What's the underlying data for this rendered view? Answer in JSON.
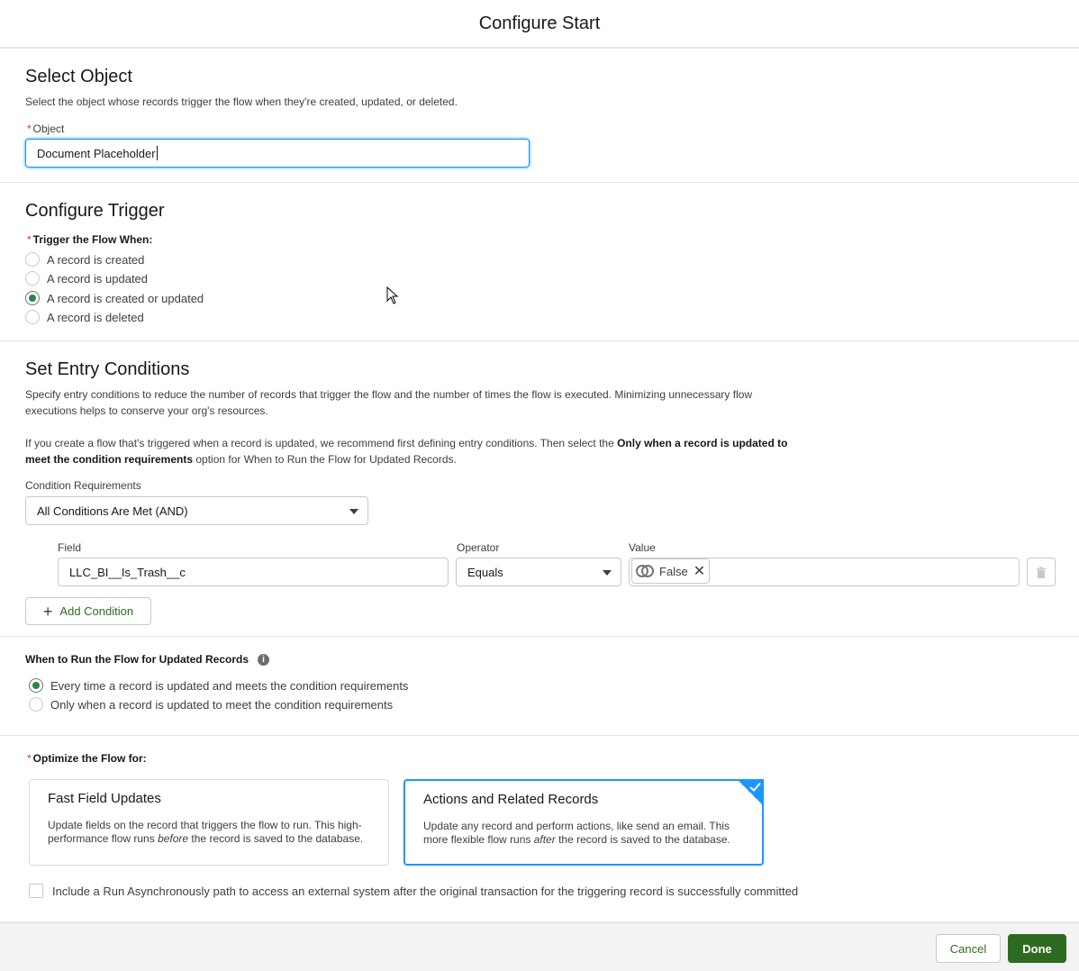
{
  "modal": {
    "title": "Configure Start"
  },
  "select_object": {
    "title": "Select Object",
    "help": "Select the object whose records trigger the flow when they're created, updated, or deleted.",
    "object_label": "Object",
    "object_value": "Document Placeholder"
  },
  "trigger": {
    "title": "Configure Trigger",
    "label": "Trigger the Flow When:",
    "options": [
      {
        "label": "A record is created",
        "checked": false
      },
      {
        "label": "A record is updated",
        "checked": false
      },
      {
        "label": "A record is created or updated",
        "checked": true
      },
      {
        "label": "A record is deleted",
        "checked": false
      }
    ]
  },
  "entry": {
    "title": "Set Entry Conditions",
    "help1": "Specify entry conditions to reduce the number of records that trigger the flow and the number of times the flow is executed. Minimizing unnecessary flow executions helps to conserve your org's resources.",
    "help2_a": "If you create a flow that's triggered when a record is updated, we recommend first defining entry conditions. Then select the ",
    "help2_bold": "Only when a record is updated to meet the condition requirements",
    "help2_b": " option for When to Run the Flow for Updated Records.",
    "req_label": "Condition Requirements",
    "req_value": "All Conditions Are Met (AND)",
    "field_label": "Field",
    "field_value": "LLC_BI__Is_Trash__c",
    "operator_label": "Operator",
    "operator_value": "Equals",
    "value_label": "Value",
    "value_pill": "False",
    "add_condition": "Add Condition"
  },
  "when_run": {
    "label": "When to Run the Flow for Updated Records",
    "options": [
      {
        "label": "Every time a record is updated and meets the condition requirements",
        "checked": true
      },
      {
        "label": "Only when a record is updated to meet the condition requirements",
        "checked": false
      }
    ]
  },
  "optimize": {
    "label": "Optimize the Flow for:",
    "card1": {
      "title": "Fast Field Updates",
      "desc_a": "Update fields on the record that triggers the flow to run. This high-performance flow runs ",
      "desc_em": "before",
      "desc_b": " the record is saved to the database."
    },
    "card2": {
      "title": "Actions and Related Records",
      "desc_a": "Update any record and perform actions, like send an email. This more flexible flow runs ",
      "desc_em": "after",
      "desc_b": " the record is saved to the database."
    },
    "async_label": "Include a Run Asynchronously path to access an external system after the original transaction for the triggering record is successfully committed"
  },
  "footer": {
    "cancel": "Cancel",
    "done": "Done"
  },
  "colors": {
    "accent_green": "#2e844a",
    "brand_button": "#2e6b22",
    "focus_blue": "#1b96ff",
    "required_red": "#c23934"
  }
}
